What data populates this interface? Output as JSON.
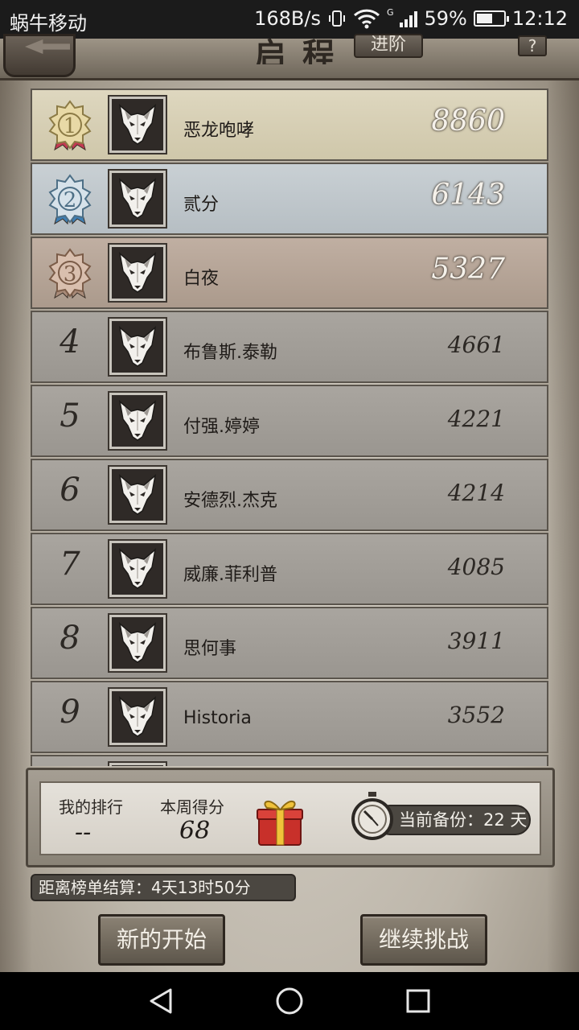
{
  "status_bar": {
    "carrier": "蜗牛移动",
    "speed": "168B/s",
    "network_type": "G",
    "battery": "59%",
    "battery_level": 0.59,
    "time": "12:12"
  },
  "header": {
    "title": "启程",
    "advance_label": "进阶",
    "help_label": "?"
  },
  "rankings": [
    {
      "rank": "1",
      "name": "恶龙咆哮",
      "score": "8860",
      "tier": "gold"
    },
    {
      "rank": "2",
      "name": "贰分",
      "score": "6143",
      "tier": "silver"
    },
    {
      "rank": "3",
      "name": "白夜",
      "score": "5327",
      "tier": "bronze"
    },
    {
      "rank": "4",
      "name": "布鲁斯.泰勒",
      "score": "4661",
      "tier": "normal"
    },
    {
      "rank": "5",
      "name": "付强.婷婷",
      "score": "4221",
      "tier": "normal"
    },
    {
      "rank": "6",
      "name": "安德烈.杰克",
      "score": "4214",
      "tier": "normal"
    },
    {
      "rank": "7",
      "name": "威廉.菲利普",
      "score": "4085",
      "tier": "normal"
    },
    {
      "rank": "8",
      "name": "思何事",
      "score": "3911",
      "tier": "normal"
    },
    {
      "rank": "9",
      "name": "Historia",
      "score": "3552",
      "tier": "normal"
    }
  ],
  "summary": {
    "my_rank_label": "我的排行",
    "my_rank_value": "--",
    "weekly_score_label": "本周得分",
    "weekly_score_value": "68",
    "backup_text": "当前备份：22 天"
  },
  "settlement": {
    "label": "距离榜单结算：",
    "value": "4天13时50分"
  },
  "buttons": {
    "new_start": "新的开始",
    "continue": "继续挑战"
  },
  "colors": {
    "gold_row": "#d8d1b8",
    "silver_row": "#c1c9cd",
    "bronze_row": "#b5a496",
    "normal_row": "#a29e98"
  }
}
